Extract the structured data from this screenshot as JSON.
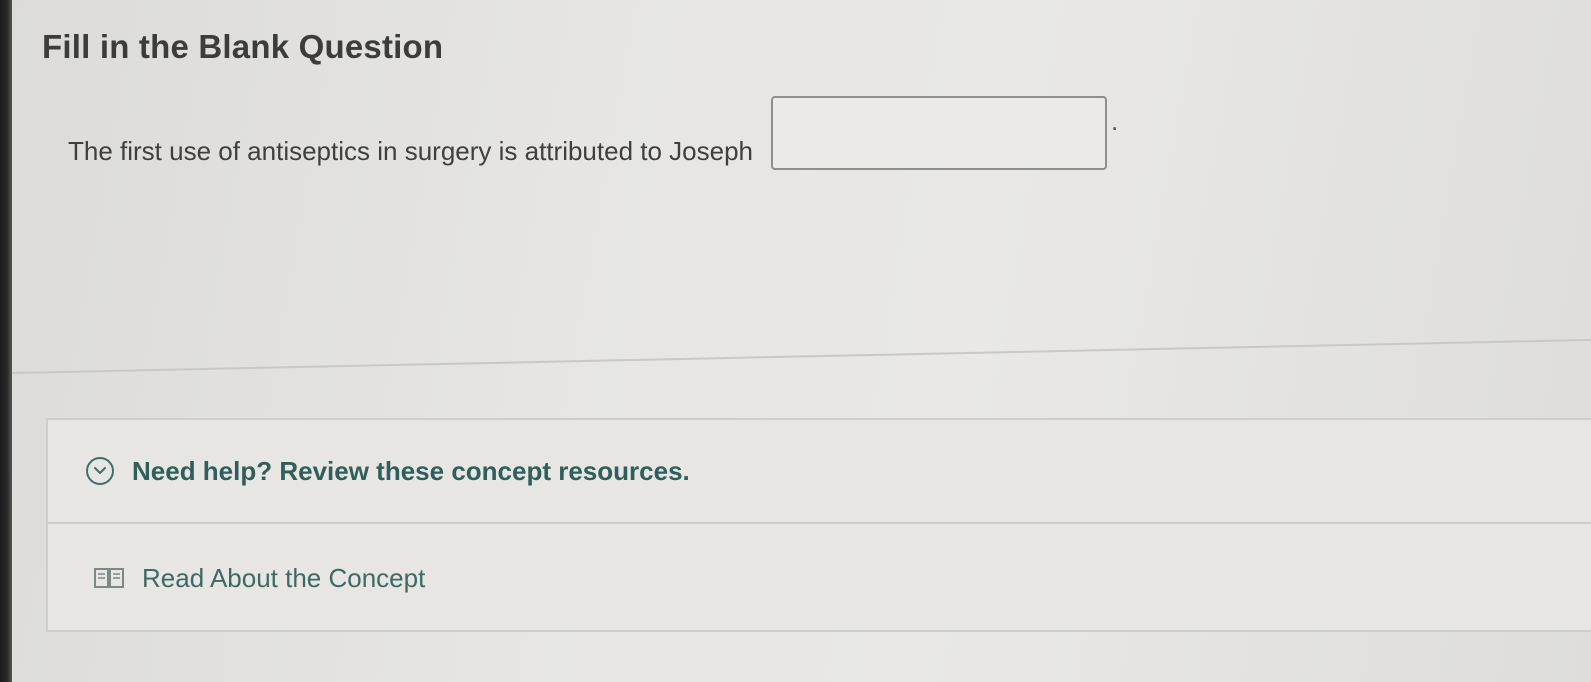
{
  "question": {
    "heading": "Fill in the Blank Question",
    "prompt": "The first use of antiseptics in surgery is attributed to Joseph",
    "answer_value": "",
    "trailing_punctuation": "."
  },
  "resources": {
    "help_label": "Need help? Review these concept resources.",
    "items": [
      {
        "label": "Read About the Concept",
        "icon": "book-icon"
      }
    ]
  },
  "colors": {
    "accent": "#2f5f5c",
    "text": "#3f3f3f",
    "border": "#cfceca"
  }
}
